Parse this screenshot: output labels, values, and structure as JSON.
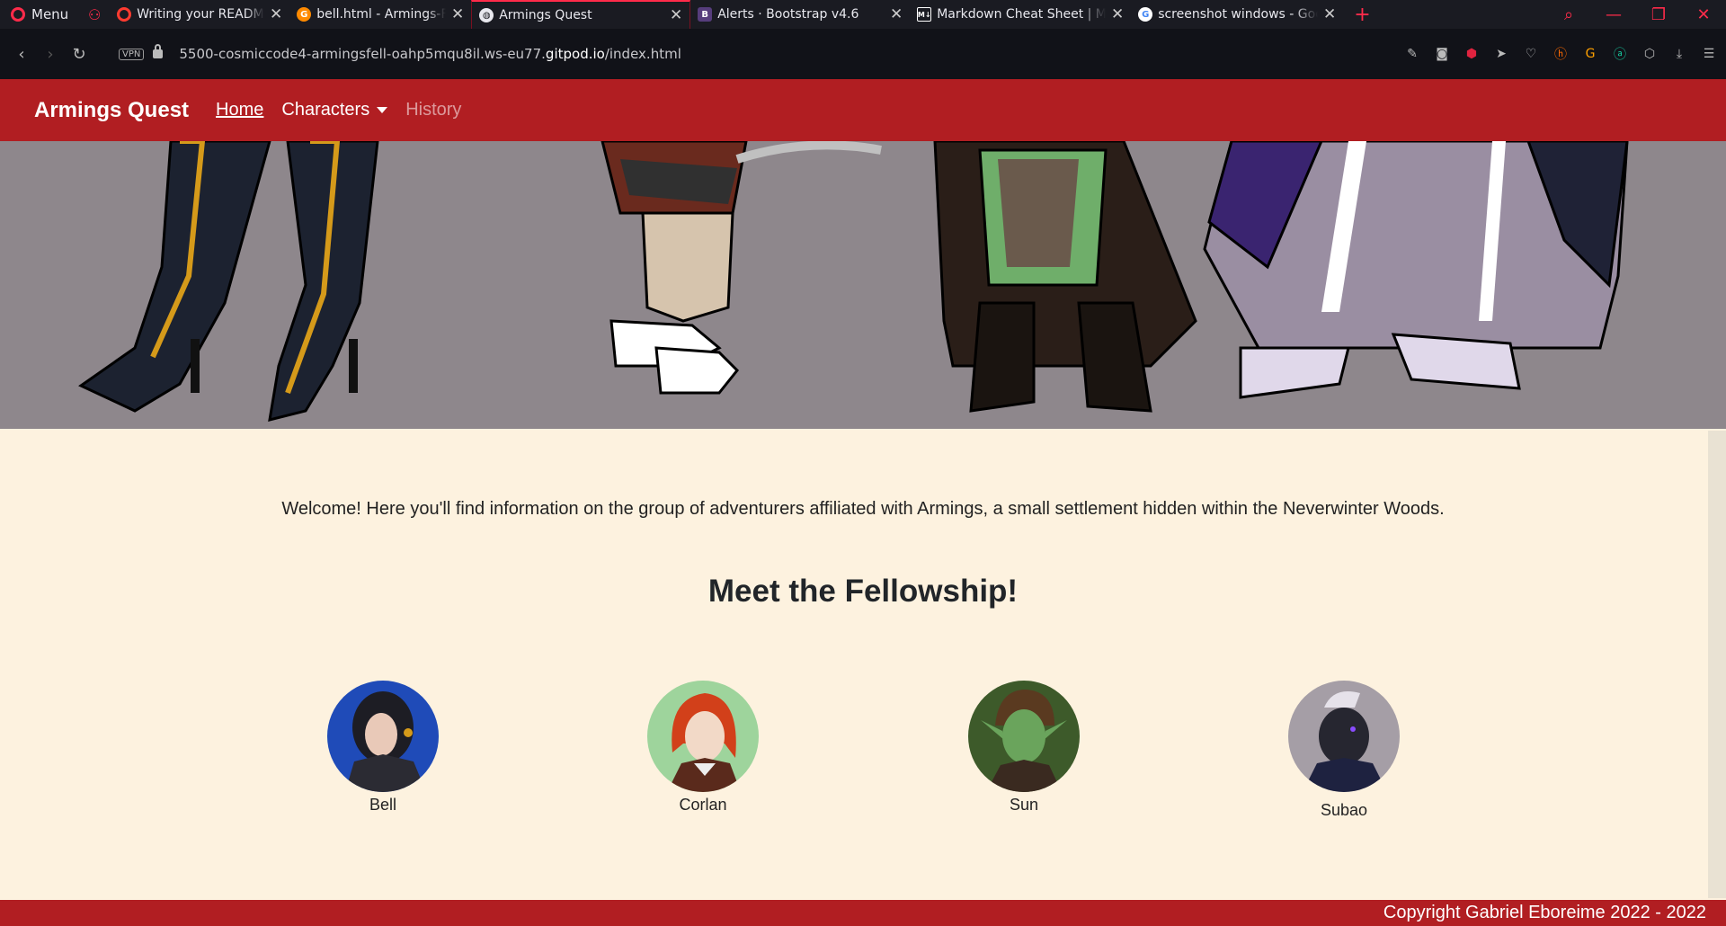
{
  "browser": {
    "menu_label": "Menu",
    "tabs": [
      {
        "title": "Writing your README - Ma",
        "favicon": "opera-icon",
        "color": "#ff3b30"
      },
      {
        "title": "bell.html - Armings-Fellow",
        "favicon": "gitpod-icon",
        "color": "#ff8a00"
      },
      {
        "title": "Armings Quest",
        "favicon": "globe-icon",
        "color": "#ffffff"
      },
      {
        "title": "Alerts · Bootstrap v4.6",
        "favicon": "bootstrap-icon",
        "color": "#563d7c"
      },
      {
        "title": "Markdown Cheat Sheet | M",
        "favicon": "markdown-icon",
        "color": "#ffffff"
      },
      {
        "title": "screenshot windows - Goo",
        "favicon": "google-icon",
        "color": "#4285f4"
      }
    ],
    "url_prefix": "5500-cosmiccode4-armingsfell-oahp5mqu8il.ws-eu77.",
    "url_domain": "gitpod.io",
    "url_path": "/index.html",
    "vpn_label": "VPN"
  },
  "site": {
    "brand": "Armings Quest",
    "nav": {
      "home": "Home",
      "characters": "Characters",
      "history": "History"
    },
    "welcome": "Welcome! Here you'll find information on the group of adventurers affiliated with Armings, a small settlement hidden within the Neverwinter Woods.",
    "heading": "Meet the Fellowship!",
    "characters": [
      {
        "name": "Bell"
      },
      {
        "name": "Corlan"
      },
      {
        "name": "Sun"
      },
      {
        "name": "Subao"
      }
    ],
    "footer": "Copyright Gabriel Eboreime 2022 - 2022"
  },
  "colors": {
    "brand_red": "#b11e22",
    "page_bg": "#fdf2df",
    "hero_bg": "#8e878c",
    "opera_red": "#ff2b4a"
  }
}
